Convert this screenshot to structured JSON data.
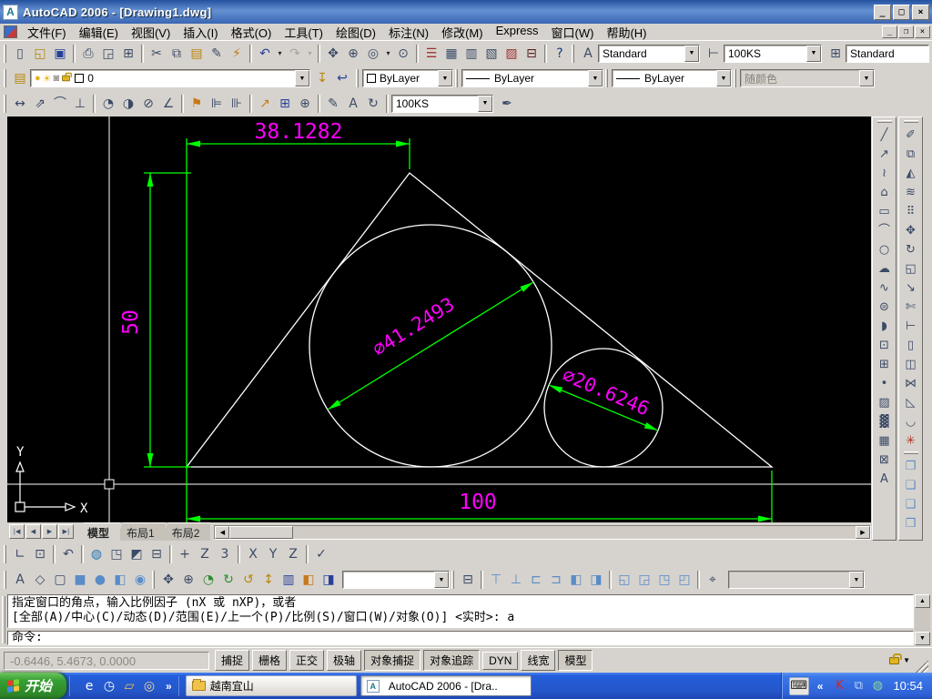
{
  "window": {
    "title": "AutoCAD 2006 - [Drawing1.dwg]",
    "app_icon": "A",
    "controls": {
      "minimize": "_",
      "maximize": "□",
      "close": "×"
    }
  },
  "menu_bar": {
    "items": [
      {
        "name": "menu-file",
        "label": "文件(F)"
      },
      {
        "name": "menu-edit",
        "label": "编辑(E)"
      },
      {
        "name": "menu-view",
        "label": "视图(V)"
      },
      {
        "name": "menu-insert",
        "label": "插入(I)"
      },
      {
        "name": "menu-format",
        "label": "格式(O)"
      },
      {
        "name": "menu-tools",
        "label": "工具(T)"
      },
      {
        "name": "menu-draw",
        "label": "绘图(D)"
      },
      {
        "name": "menu-dimension",
        "label": "标注(N)"
      },
      {
        "name": "menu-modify",
        "label": "修改(M)"
      },
      {
        "name": "menu-express",
        "label": "Express"
      },
      {
        "name": "menu-window",
        "label": "窗口(W)"
      },
      {
        "name": "menu-help",
        "label": "帮助(H)"
      }
    ],
    "doc_controls": {
      "minimize": "_",
      "restore": "❐",
      "close": "×"
    }
  },
  "toolbars": {
    "standard": [
      {
        "name": "new-file-button",
        "glyph": "▯"
      },
      {
        "name": "open-file-button",
        "glyph": "◱",
        "color": "#b8860b"
      },
      {
        "name": "save-button",
        "glyph": "▣",
        "color": "#27409a"
      },
      "|",
      {
        "name": "plot-button",
        "glyph": "⎙"
      },
      {
        "name": "plot-preview-button",
        "glyph": "◲"
      },
      {
        "name": "publish-button",
        "glyph": "⊞"
      },
      "|",
      {
        "name": "cut-button",
        "glyph": "✂"
      },
      {
        "name": "copy-button",
        "glyph": "⧉"
      },
      {
        "name": "paste-button",
        "glyph": "▤",
        "color": "#b8860b"
      },
      {
        "name": "match-properties-button",
        "glyph": "✎"
      },
      {
        "name": "block-editor-button",
        "glyph": "⚡",
        "color": "#c87818"
      },
      "|",
      {
        "name": "undo-button",
        "glyph": "↶",
        "color": "#27409a",
        "drop": true
      },
      {
        "name": "redo-button",
        "glyph": "↷",
        "disabled": true,
        "drop": true
      },
      "|",
      {
        "name": "pan-realtime-button",
        "glyph": "✥"
      },
      {
        "name": "zoom-realtime-button",
        "glyph": "⊕"
      },
      {
        "name": "zoom-window-button",
        "glyph": "◎",
        "drop": true
      },
      {
        "name": "zoom-previous-button",
        "glyph": "⊙"
      },
      "|",
      {
        "name": "properties-palette-button",
        "glyph": "☰",
        "color": "#a03030"
      },
      {
        "name": "designcenter-button",
        "glyph": "▦"
      },
      {
        "name": "tool-palettes-button",
        "glyph": "▥"
      },
      {
        "name": "sheet-set-manager-button",
        "glyph": "▧"
      },
      {
        "name": "markup-set-manager-button",
        "glyph": "▨",
        "color": "#a03030"
      },
      {
        "name": "quickcalc-button",
        "glyph": "⊟",
        "color": "#5a2020"
      },
      "|",
      {
        "name": "help-button",
        "glyph": "?",
        "color": "#1a3c8c"
      }
    ],
    "styles_left": [
      {
        "name": "text-style-button",
        "glyph": "A"
      }
    ],
    "styles_mid": [
      {
        "name": "dim-style-button",
        "glyph": "⊢"
      }
    ],
    "styles_right": [
      {
        "name": "table-style-button",
        "glyph": "⊞"
      }
    ],
    "styles": {
      "text_style": "Standard",
      "dim_style": "100KS",
      "table_style": "Standard"
    },
    "layers_left": [
      {
        "name": "layer-properties-manager-button",
        "glyph": "▤",
        "color": "#b8860b"
      }
    ],
    "layers_right": [
      {
        "name": "make-object-layer-current-button",
        "glyph": "↧",
        "color": "#b8860b"
      },
      {
        "name": "layer-previous-button",
        "glyph": "↩",
        "color": "#27409a"
      }
    ],
    "layers": {
      "current_layer": "0"
    },
    "properties": {
      "color": "ByLayer",
      "linetype": "ByLayer",
      "lineweight": "ByLayer",
      "plot_style": "随颜色"
    },
    "dimension": [
      {
        "name": "linear-dimension-button",
        "glyph": "↔"
      },
      {
        "name": "aligned-dimension-button",
        "glyph": "⇗"
      },
      {
        "name": "arc-length-dimension-button",
        "glyph": "⌒"
      },
      {
        "name": "ordinate-dimension-button",
        "glyph": "⊥"
      },
      "|",
      {
        "name": "radius-dimension-button",
        "glyph": "◔"
      },
      {
        "name": "jogged-dimension-button",
        "glyph": "◑"
      },
      {
        "name": "diameter-dimension-button",
        "glyph": "⊘"
      },
      {
        "name": "angular-dimension-button",
        "glyph": "∠"
      },
      "|",
      {
        "name": "quick-dimension-button",
        "glyph": "⚑",
        "color": "#c87818"
      },
      {
        "name": "baseline-dimension-button",
        "glyph": "⊫"
      },
      {
        "name": "continue-dimension-button",
        "glyph": "⊪"
      },
      "|",
      {
        "name": "quick-leader-button",
        "glyph": "↗",
        "color": "#c87818"
      },
      {
        "name": "tolerance-button",
        "glyph": "⊞",
        "color": "#27409a"
      },
      {
        "name": "center-mark-button",
        "glyph": "⊕"
      },
      "|",
      {
        "name": "dimension-edit-button",
        "glyph": "✎"
      },
      {
        "name": "dimension-text-edit-button",
        "glyph": "A"
      },
      {
        "name": "dimension-update-button",
        "glyph": "↻"
      },
      "|"
    ],
    "dimension_style_value": "100KS",
    "dimension_right": [
      {
        "name": "dimension-style-dialog-button",
        "glyph": "✒"
      }
    ],
    "ucs": [
      {
        "name": "ucs-button",
        "glyph": "∟"
      },
      {
        "name": "ucs-dialog-button",
        "glyph": "⊡"
      },
      "|",
      {
        "name": "ucs-previous-button",
        "glyph": "↶"
      },
      "|",
      {
        "name": "world-ucs-button",
        "glyph": "◍",
        "color": "#2878b8"
      },
      {
        "name": "object-ucs-button",
        "glyph": "◳"
      },
      {
        "name": "face-ucs-button",
        "glyph": "◩"
      },
      {
        "name": "view-ucs-button",
        "glyph": "⊟"
      },
      "|",
      {
        "name": "origin-ucs-button",
        "glyph": "+"
      },
      {
        "name": "z-axis-vector-ucs-button",
        "glyph": "Z"
      },
      {
        "name": "three-point-ucs-button",
        "glyph": "3"
      },
      "|",
      {
        "name": "x-rotate-ucs-button",
        "glyph": "X"
      },
      {
        "name": "y-rotate-ucs-button",
        "glyph": "Y"
      },
      {
        "name": "z-rotate-ucs-button",
        "glyph": "Z"
      },
      "|",
      {
        "name": "apply-ucs-button",
        "glyph": "✓"
      }
    ],
    "shade": [
      {
        "name": "2d-wireframe-button",
        "glyph": "A"
      },
      {
        "name": "3d-wireframe-button",
        "glyph": "◇"
      },
      {
        "name": "hidden-button",
        "glyph": "▢"
      },
      {
        "name": "flat-shaded-button",
        "glyph": "■",
        "color": "#5a8cc8"
      },
      {
        "name": "gouraud-shaded-button",
        "glyph": "●",
        "color": "#5a8cc8"
      },
      {
        "name": "flat-shaded-edges-on-button",
        "glyph": "◧",
        "color": "#5a8cc8"
      },
      {
        "name": "gouraud-shaded-edges-on-button",
        "glyph": "◉",
        "color": "#5a8cc8"
      }
    ],
    "orbit": [
      {
        "name": "3d-pan-button",
        "glyph": "✥"
      },
      {
        "name": "3d-zoom-button",
        "glyph": "⊕"
      },
      {
        "name": "3d-orbit-button",
        "glyph": "◔",
        "color": "#2e8b2e"
      },
      {
        "name": "3d-continuous-orbit-button",
        "glyph": "↻",
        "color": "#2e8b2e"
      },
      {
        "name": "3d-swivel-button",
        "glyph": "↺",
        "color": "#b8860b"
      },
      {
        "name": "3d-adjust-distance-button",
        "glyph": "↕",
        "color": "#b8860b"
      },
      {
        "name": "3d-adjust-clip-planes-button",
        "glyph": "▥",
        "color": "#27409a"
      },
      {
        "name": "front-clip-on-off-button",
        "glyph": "◧",
        "color": "#c87818"
      },
      {
        "name": "back-clip-on-off-button",
        "glyph": "◨",
        "color": "#27409a"
      }
    ],
    "views": [
      {
        "name": "named-views-button",
        "glyph": "⊟"
      },
      "|",
      {
        "name": "top-view-button",
        "glyph": "⊤",
        "color": "#5a8cc8"
      },
      {
        "name": "bottom-view-button",
        "glyph": "⊥",
        "color": "#5a8cc8"
      },
      {
        "name": "left-view-button",
        "glyph": "⊏",
        "color": "#5a8cc8"
      },
      {
        "name": "right-view-button",
        "glyph": "⊐",
        "color": "#5a8cc8"
      },
      {
        "name": "front-view-button",
        "glyph": "◧",
        "color": "#5a8cc8"
      },
      {
        "name": "back-view-button",
        "glyph": "◨",
        "color": "#5a8cc8"
      },
      "|",
      {
        "name": "sw-isometric-view-button",
        "glyph": "◱",
        "color": "#5a8cc8"
      },
      {
        "name": "se-isometric-view-button",
        "glyph": "◲",
        "color": "#5a8cc8"
      },
      {
        "name": "ne-isometric-view-button",
        "glyph": "◳",
        "color": "#5a8cc8"
      },
      {
        "name": "nw-isometric-view-button",
        "glyph": "◰",
        "color": "#5a8cc8"
      },
      "|",
      {
        "name": "camera-button",
        "glyph": "⌖"
      }
    ],
    "draw": [
      {
        "name": "line-button",
        "glyph": "╱"
      },
      {
        "name": "construction-line-button",
        "glyph": "↗"
      },
      {
        "name": "polyline-button",
        "glyph": "≀"
      },
      {
        "name": "polygon-button",
        "glyph": "⌂"
      },
      {
        "name": "rectangle-button",
        "glyph": "▭"
      },
      {
        "name": "arc-button",
        "glyph": "⌒"
      },
      {
        "name": "circle-button",
        "glyph": "○"
      },
      {
        "name": "revision-cloud-button",
        "glyph": "☁"
      },
      {
        "name": "spline-button",
        "glyph": "∿"
      },
      {
        "name": "ellipse-button",
        "glyph": "⊜"
      },
      {
        "name": "ellipse-arc-button",
        "glyph": "◗"
      },
      {
        "name": "insert-block-button",
        "glyph": "⊡"
      },
      {
        "name": "make-block-button",
        "glyph": "⊞"
      },
      {
        "name": "point-button",
        "glyph": "•"
      },
      {
        "name": "hatch-button",
        "glyph": "▨"
      },
      {
        "name": "gradient-button",
        "glyph": "▓"
      },
      {
        "name": "region-button",
        "glyph": "▦"
      },
      {
        "name": "table-button",
        "glyph": "⊠"
      },
      {
        "name": "multiline-text-button",
        "glyph": "A"
      }
    ],
    "modify": [
      {
        "name": "erase-button",
        "glyph": "✐"
      },
      {
        "name": "copy-button-modify",
        "glyph": "⧉"
      },
      {
        "name": "mirror-button",
        "glyph": "◭"
      },
      {
        "name": "offset-button",
        "glyph": "≋"
      },
      {
        "name": "array-button",
        "glyph": "⠿"
      },
      {
        "name": "move-button",
        "glyph": "✥"
      },
      {
        "name": "rotate-button",
        "glyph": "↻"
      },
      {
        "name": "scale-button",
        "glyph": "◱"
      },
      {
        "name": "stretch-button",
        "glyph": "↘"
      },
      {
        "name": "trim-button",
        "glyph": "✄"
      },
      {
        "name": "extend-button",
        "glyph": "⊢"
      },
      {
        "name": "break-at-point-button",
        "glyph": "▯"
      },
      {
        "name": "break-button",
        "glyph": "◫"
      },
      {
        "name": "join-button",
        "glyph": "⋈"
      },
      {
        "name": "chamfer-button",
        "glyph": "◺"
      },
      {
        "name": "fillet-button",
        "glyph": "◡"
      },
      {
        "name": "explode-button",
        "glyph": "✳",
        "color": "#b03020"
      }
    ],
    "draw_order": [
      {
        "name": "bring-to-front-button",
        "glyph": "❐",
        "color": "#5a8cc8"
      },
      {
        "name": "send-to-back-button",
        "glyph": "❏",
        "color": "#5a8cc8"
      },
      {
        "name": "bring-above-objects-button",
        "glyph": "❑",
        "color": "#5a8cc8"
      },
      {
        "name": "send-under-objects-button",
        "glyph": "❒",
        "color": "#5a8cc8"
      }
    ]
  },
  "drawing": {
    "dimensions": {
      "top_width": "38.1282",
      "left_height": "50",
      "bottom_width": "100",
      "large_circle_diameter": "∅41.2493",
      "small_circle_diameter": "∅20.6246"
    },
    "ucs_icon": {
      "x": "X",
      "y": "Y"
    }
  },
  "layout_tabs": {
    "nav": [
      {
        "name": "tab-first-button",
        "glyph": "|◀"
      },
      {
        "name": "tab-prev-button",
        "glyph": "◀"
      },
      {
        "name": "tab-next-button",
        "glyph": "▶"
      },
      {
        "name": "tab-last-button",
        "glyph": "▶|"
      }
    ],
    "tabs": [
      {
        "name": "model",
        "label": "模型",
        "active": true
      },
      {
        "name": "layout1",
        "label": "布局1",
        "active": false
      },
      {
        "name": "layout2",
        "label": "布局2",
        "active": false
      }
    ]
  },
  "command_window": {
    "history": [
      "指定窗口的角点，输入比例因子 (nX 或 nXP)，或者",
      "[全部(A)/中心(C)/动态(D)/范围(E)/上一个(P)/比例(S)/窗口(W)/对象(O)] <实时>: a"
    ],
    "prompt": "命令:"
  },
  "status_bar": {
    "coordinates": "-0.6446, 5.4673, 0.0000",
    "toggles": [
      {
        "name": "snap",
        "label": "捕捉",
        "pressed": false
      },
      {
        "name": "grid",
        "label": "栅格",
        "pressed": false
      },
      {
        "name": "ortho",
        "label": "正交",
        "pressed": false
      },
      {
        "name": "polar",
        "label": "极轴",
        "pressed": false
      },
      {
        "name": "osnap",
        "label": "对象捕捉",
        "pressed": true
      },
      {
        "name": "otrack",
        "label": "对象追踪",
        "pressed": true
      },
      {
        "name": "dyn",
        "label": "DYN",
        "pressed": false
      },
      {
        "name": "lwt",
        "label": "线宽",
        "pressed": false
      },
      {
        "name": "model",
        "label": "模型",
        "pressed": true
      }
    ]
  },
  "taskbar": {
    "start_label": "开始",
    "quick_launch": [
      {
        "name": "quicklaunch-ie-icon",
        "glyph": "e"
      },
      {
        "name": "quicklaunch-time-icon",
        "glyph": "◷"
      },
      {
        "name": "quicklaunch-folder-icon",
        "glyph": "▱",
        "color": "#f0c24a"
      },
      {
        "name": "quicklaunch-viewer-icon",
        "glyph": "◎",
        "color": "#f0d8a0"
      }
    ],
    "overflow_chevron": "»",
    "tasks": [
      {
        "name": "folder",
        "label": "越南宜山",
        "icon": "folder-icon",
        "active": false
      },
      {
        "name": "autocad",
        "label": "AutoCAD 2006 - [Dra..",
        "icon": "autocad-icon",
        "active": true
      }
    ],
    "tray_chevron": "«",
    "tray_icons": [
      {
        "name": "tray-kaspersky-icon",
        "glyph": "K",
        "color": "#e02020"
      },
      {
        "name": "tray-network-icon",
        "glyph": "⧉",
        "color": "#bcd8ff"
      },
      {
        "name": "tray-globe-icon",
        "glyph": "◍",
        "color": "#8fd4a0"
      }
    ],
    "clock": "10:54"
  },
  "colors": {
    "dim_line": "#00ff00",
    "dim_text": "#ff00ff",
    "geometry": "#ffffff",
    "canvas_bg": "#000000",
    "chrome_bg": "#d6d3ce",
    "taskbar_blue": "#245edb",
    "start_green": "#37a033"
  }
}
